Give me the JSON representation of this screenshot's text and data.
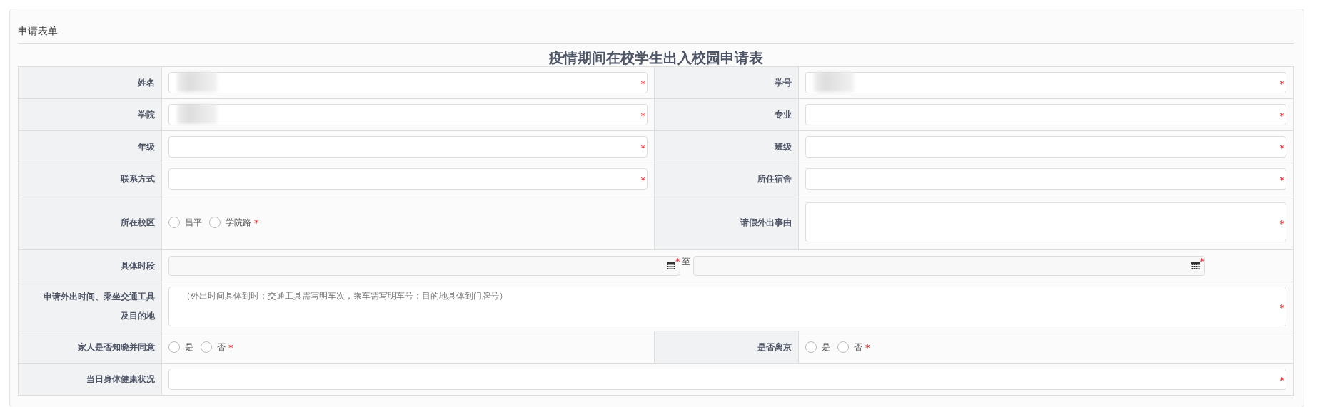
{
  "panel": {
    "title": "申请表单"
  },
  "form": {
    "title": "疫情期间在校学生出入校园申请表",
    "rows": [
      {
        "fields": [
          {
            "label": "姓名",
            "kind": "text",
            "mark": "*",
            "redacted": true
          },
          {
            "label": "学号",
            "kind": "text",
            "mark": "*",
            "redacted": true
          }
        ]
      },
      {
        "fields": [
          {
            "label": "学院",
            "kind": "text",
            "mark": "*",
            "redacted": true
          },
          {
            "label": "专业",
            "kind": "text",
            "mark": "*",
            "redacted": false
          }
        ]
      },
      {
        "fields": [
          {
            "label": "年级",
            "kind": "text",
            "mark": "*",
            "redacted": false
          },
          {
            "label": "班级",
            "kind": "text",
            "mark": "*",
            "redacted": false
          }
        ]
      },
      {
        "fields": [
          {
            "label": "联系方式",
            "kind": "text",
            "mark": "*",
            "redacted": false
          },
          {
            "label": "所住宿舍",
            "kind": "text",
            "mark": "*",
            "redacted": false
          }
        ]
      },
      {
        "fields": [
          {
            "label": "所在校区",
            "kind": "radio",
            "mark": "*",
            "options": [
              {
                "label": "昌平",
                "selected": false
              },
              {
                "label": "学院路",
                "selected": false
              }
            ]
          },
          {
            "label": "请假外出事由",
            "kind": "textarea",
            "mark": "*"
          }
        ]
      },
      {
        "fields": [
          {
            "label": "具体时段",
            "kind": "daterange",
            "mark": "*",
            "end_mark": "*",
            "separator": "至"
          }
        ]
      },
      {
        "fields": [
          {
            "label": "申请外出时间、乘坐交通工具及目的地",
            "kind": "textarea",
            "mark": "*",
            "placeholder": "（外出时间具体到时；交通工具需写明车次，乘车需写明车号；目的地具体到门牌号）"
          }
        ]
      },
      {
        "fields": [
          {
            "label": "家人是否知晓并同意",
            "kind": "radio",
            "mark": "*",
            "options": [
              {
                "label": "是",
                "selected": false
              },
              {
                "label": "否",
                "selected": false
              }
            ]
          },
          {
            "label": "是否离京",
            "kind": "radio",
            "mark": "*",
            "options": [
              {
                "label": "是",
                "selected": false
              },
              {
                "label": "否",
                "selected": false
              }
            ]
          }
        ]
      },
      {
        "fields": [
          {
            "label": "当日身体健康状况",
            "kind": "text",
            "mark": "*",
            "redacted": false
          }
        ]
      }
    ]
  }
}
